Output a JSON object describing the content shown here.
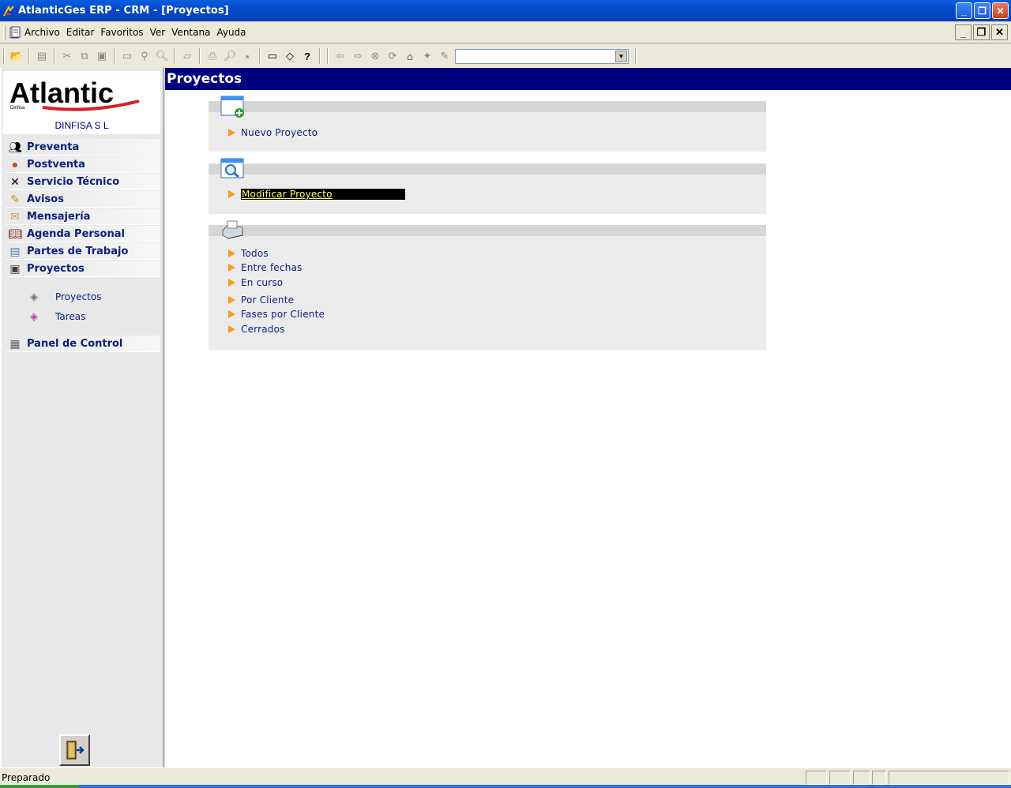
{
  "window": {
    "title": "AtlanticGes ERP - CRM - [Proyectos]"
  },
  "menu": {
    "items": [
      "Archivo",
      "Editar",
      "Favoritos",
      "Ver",
      "Ventana",
      "Ayuda"
    ]
  },
  "toolbar": {
    "combo_value": ""
  },
  "sidebar": {
    "logo_text": "Atlantic",
    "logo_subtext": "Dinfisa",
    "company": "DINFISA  S L",
    "nav": [
      {
        "label": "Preventa",
        "icon": "people-icon"
      },
      {
        "label": "Postventa",
        "icon": "person-icon"
      },
      {
        "label": "Servicio Técnico",
        "icon": "tools-icon"
      },
      {
        "label": "Avisos",
        "icon": "pencil-icon"
      },
      {
        "label": "Mensajería",
        "icon": "envelope-icon"
      },
      {
        "label": "Agenda Personal",
        "icon": "book-icon"
      },
      {
        "label": "Partes de Trabajo",
        "icon": "document-icon"
      },
      {
        "label": "Proyectos",
        "icon": "monitor-icon"
      }
    ],
    "sub": [
      {
        "label": "Proyectos",
        "icon": "folder-icon"
      },
      {
        "label": "Tareas",
        "icon": "tasks-icon"
      }
    ],
    "panel": {
      "label": "Panel de Control",
      "icon": "calendar-icon"
    }
  },
  "main": {
    "header": "Proyectos",
    "sections": [
      {
        "icon": "new-window-icon",
        "links": [
          "Nuevo Proyecto"
        ]
      },
      {
        "icon": "search-window-icon",
        "links": [
          "Modificar Proyecto"
        ]
      },
      {
        "icon": "printer-icon",
        "links": [
          "Todos",
          "Entre fechas",
          "En curso",
          "Por Cliente",
          "Fases por Cliente",
          "Cerrados"
        ]
      }
    ]
  },
  "statusbar": {
    "text": "Preparado"
  }
}
